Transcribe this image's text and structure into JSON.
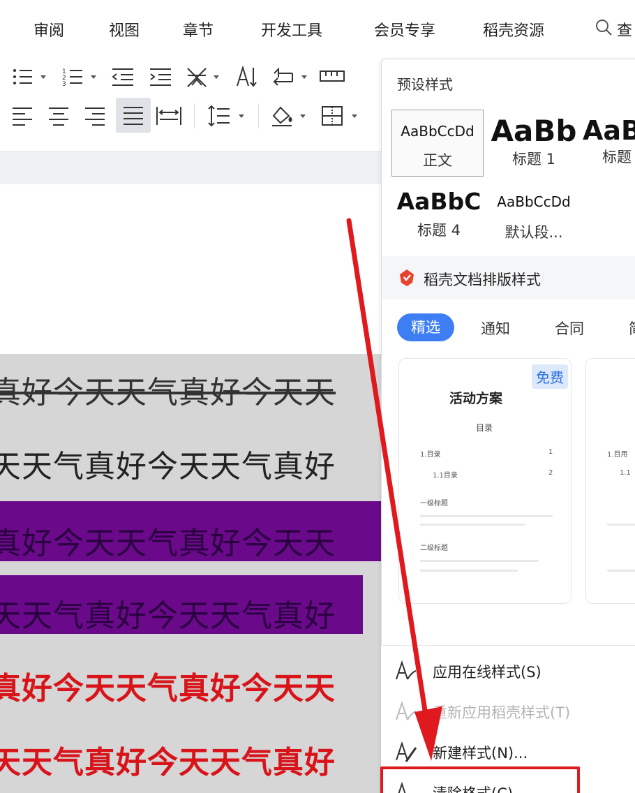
{
  "menubar": {
    "items": [
      "审阅",
      "视图",
      "章节",
      "开发工具",
      "会员专享",
      "稻壳资源"
    ],
    "search_label": "查"
  },
  "toolbar": {
    "icons": [
      "bullet-list-icon",
      "numbered-list-icon",
      "decrease-indent-icon",
      "increase-indent-icon",
      "chinese-layout-icon",
      "text-direction-icon",
      "line-spacing-mark-icon",
      "tab-stops-icon",
      "align-left-icon",
      "align-center-icon",
      "align-right-icon",
      "justify-icon",
      "distributed-align-icon",
      "line-spacing-icon",
      "shading-icon",
      "borders-icon"
    ]
  },
  "document": {
    "lines": [
      "真好今天天气真好今天天",
      "天天气真好今天天气真好",
      "真好今天天气真好今天天",
      "天天气真好今天天气真好",
      "真好今天天气真好今天天",
      "天天气真好今天天气真好"
    ],
    "highlight_color": "#6a0a8a",
    "red_text_color": "#d8141a"
  },
  "panel": {
    "title": "预设样式",
    "styles": [
      {
        "sample": "AaBbCcDd",
        "name": "正文"
      },
      {
        "sample": "AaBb",
        "name": "标题 1"
      },
      {
        "sample": "AaB",
        "name": "标题"
      },
      {
        "sample": "AaBbC",
        "name": "标题 4"
      },
      {
        "sample": "AaBbCcDd",
        "name": "默认段..."
      }
    ],
    "doc_styles_title": "稻壳文档排版样式",
    "tabs": [
      "精选",
      "通知",
      "合同",
      "简"
    ],
    "cards": [
      {
        "badge": "免费",
        "title": "活动方案",
        "toc_heading": "目录",
        "rows": [
          [
            "1.目录",
            "1"
          ],
          [
            "1.1目录",
            "2"
          ]
        ],
        "section1": "一级标题",
        "section2": "二级标题"
      },
      {
        "rows": [
          [
            "1.目用"
          ],
          [
            "1.1"
          ]
        ]
      }
    ]
  },
  "context_menu": {
    "items": [
      {
        "label": "应用在线样式(S)",
        "enabled": true
      },
      {
        "label": "重新应用稻壳样式(T)",
        "enabled": false
      },
      {
        "label": "新建样式(N)...",
        "enabled": true
      },
      {
        "label": "清除格式(C)",
        "enabled": true
      }
    ]
  },
  "annotation": {
    "arrow_color": "#e0191f"
  }
}
